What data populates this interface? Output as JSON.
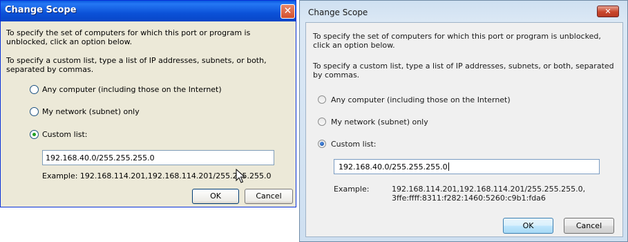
{
  "xp_dialog": {
    "title": "Change Scope",
    "close_glyph": "✕",
    "intro_text": "To specify the set of computers for which this port or program is unblocked, click an option below.",
    "custom_list_instructions": "To specify a custom list, type a list of IP addresses, subnets, or both, separated by commas.",
    "options": [
      {
        "label": "Any computer (including those on the Internet)",
        "selected": false
      },
      {
        "label": "My network (subnet) only",
        "selected": false
      },
      {
        "label": "Custom list:",
        "selected": true
      }
    ],
    "custom_list_value": "192.168.40.0/255.255.255.0",
    "example_text": "Example: 192.168.114.201,192.168.114.201/255.255.255.0",
    "ok_label": "OK",
    "cancel_label": "Cancel"
  },
  "vista_dialog": {
    "title": "Change Scope",
    "close_glyph": "✕",
    "intro_text": "To specify the set of computers for which this port or program is unblocked, click an option below.",
    "custom_list_instructions": "To specify a custom list, type a list of IP addresses, subnets, or both, separated by commas.",
    "options": [
      {
        "label": "Any computer (including those on the Internet)",
        "selected": false
      },
      {
        "label": "My network (subnet) only",
        "selected": false
      },
      {
        "label": "Custom list:",
        "selected": true
      }
    ],
    "custom_list_value": "192.168.40.0/255.255.255.0",
    "example_label": "Example:",
    "example_line1": "192.168.114.201,192.168.114.201/255.255.255.0,",
    "example_line2": "3ffe:ffff:8311:f282:1460:5260:c9b1:fda6",
    "ok_label": "OK",
    "cancel_label": "Cancel"
  }
}
